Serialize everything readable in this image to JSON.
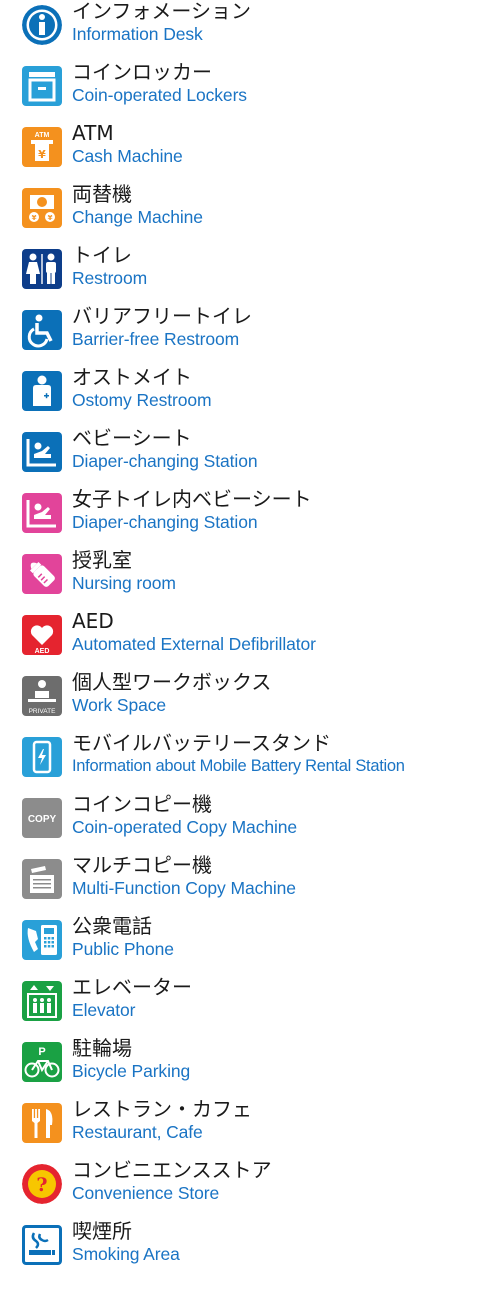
{
  "colors": {
    "label_ja": "#1a1a1a",
    "label_en": "#1a74c4",
    "blue": "#0b70b8",
    "sky": "#29a0d8",
    "orange": "#f4911e",
    "navy": "#0d3d8a",
    "pink": "#e2449a",
    "red": "#e5242f",
    "gray": "#6d6d6d",
    "green": "#1aa144",
    "yellow": "#f7c600"
  },
  "items": [
    {
      "ja": "インフォメーション",
      "en": "Information Desk",
      "icon": "information-icon"
    },
    {
      "ja": "コインロッカー",
      "en": "Coin-operated Lockers",
      "icon": "locker-icon"
    },
    {
      "ja": "ATM",
      "en": "Cash Machine",
      "icon": "atm-icon"
    },
    {
      "ja": "両替機",
      "en": "Change Machine",
      "icon": "change-machine-icon"
    },
    {
      "ja": "トイレ",
      "en": "Restroom",
      "icon": "restroom-icon"
    },
    {
      "ja": "バリアフリートイレ",
      "en": "Barrier-free Restroom",
      "icon": "wheelchair-icon"
    },
    {
      "ja": "オストメイト",
      "en": "Ostomy Restroom",
      "icon": "ostomy-icon"
    },
    {
      "ja": "ベビーシート",
      "en": "Diaper-changing Station",
      "icon": "baby-sheet-icon"
    },
    {
      "ja": "女子トイレ内ベビーシート",
      "en": "Diaper-changing Station",
      "icon": "baby-sheet-women-icon"
    },
    {
      "ja": "授乳室",
      "en": "Nursing room",
      "icon": "nursing-bottle-icon"
    },
    {
      "ja": "AED",
      "en": "Automated External Defibrillator",
      "icon": "aed-icon",
      "icon_text": "AED"
    },
    {
      "ja": "個人型ワークボックス",
      "en": "Work Space",
      "icon": "work-space-icon",
      "icon_text": "PRIVATE"
    },
    {
      "ja": "モバイルバッテリースタンド",
      "en": "Information about Mobile Battery Rental Station",
      "icon": "mobile-battery-icon"
    },
    {
      "ja": "コインコピー機",
      "en": "Coin-operated Copy Machine",
      "icon": "copy-icon",
      "icon_text": "COPY"
    },
    {
      "ja": "マルチコピー機",
      "en": "Multi-Function Copy Machine",
      "icon": "multi-copy-icon"
    },
    {
      "ja": "公衆電話",
      "en": "Public Phone",
      "icon": "phone-icon"
    },
    {
      "ja": "エレベーター",
      "en": "Elevator",
      "icon": "elevator-icon"
    },
    {
      "ja": "駐輪場",
      "en": "Bicycle Parking",
      "icon": "bicycle-icon"
    },
    {
      "ja": "レストラン・カフェ",
      "en": "Restaurant, Cafe",
      "icon": "restaurant-icon"
    },
    {
      "ja": "コンビニエンスストア",
      "en": "Convenience Store",
      "icon": "convenience-store-icon"
    },
    {
      "ja": "喫煙所",
      "en": "Smoking Area",
      "icon": "smoking-icon"
    }
  ]
}
